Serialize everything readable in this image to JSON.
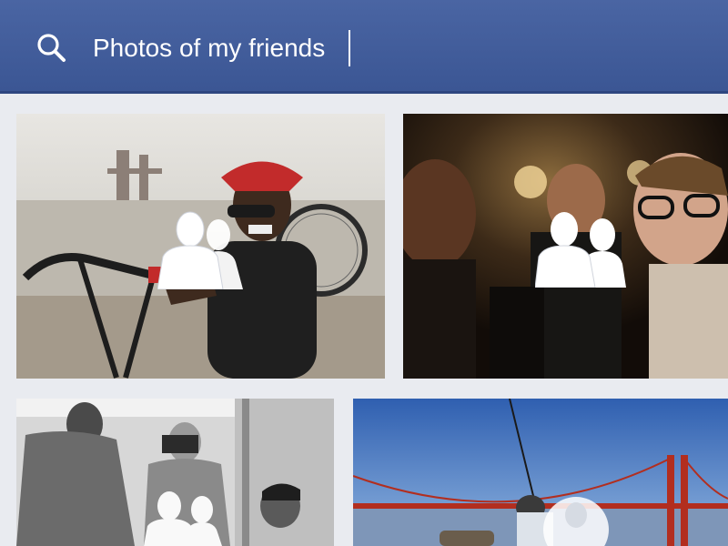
{
  "search": {
    "query": "Photos of my friends",
    "icon": "search-icon"
  },
  "colors": {
    "header": "#3b5694",
    "background": "#e9ebf0"
  },
  "photos": [
    {
      "name": "cyclist-with-bike",
      "tag_icon": "friends-icon"
    },
    {
      "name": "friends-at-bar",
      "tag_icon": "friends-icon"
    },
    {
      "name": "people-in-kitchen",
      "tag_icon": "friends-icon"
    },
    {
      "name": "golden-gate-kite",
      "tag_icon": "friend-icon"
    }
  ]
}
